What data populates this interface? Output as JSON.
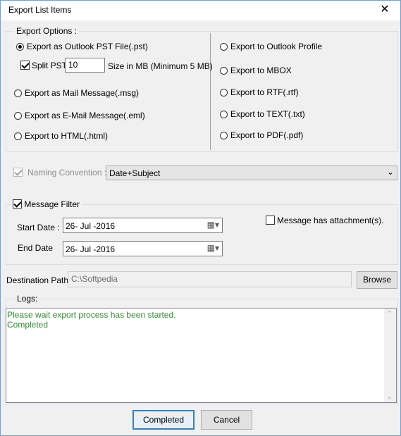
{
  "window": {
    "title": "Export List Items"
  },
  "export_options": {
    "legend": "Export Options :",
    "pst": "Export as Outlook PST File(.pst)",
    "split_pst_label": "Split PST",
    "split_size": "10",
    "size_label": "Size in MB (Minimum 5 MB)",
    "msg": "Export as Mail Message(.msg)",
    "eml": "Export as E-Mail Message(.eml)",
    "html": "Export to HTML(.html)",
    "outlook_profile": "Export to Outlook Profile",
    "mbox": "Export to MBOX",
    "rtf": "Export to RTF(.rtf)",
    "text": "Export to TEXT(.txt)",
    "pdf": "Export to PDF(.pdf)"
  },
  "naming": {
    "label": "Naming Convention :",
    "value": "Date+Subject"
  },
  "message_filter": {
    "legend": "Message Filter",
    "start_label": "Start Date :",
    "start_value": "26-  Jul  -2016",
    "end_label": "End Date",
    "end_value": "26-  Jul  -2016",
    "attachment_label": "Message has attachment(s)."
  },
  "destination": {
    "label": "Destination Path:",
    "value": "C:\\Softpedia",
    "browse": "Browse"
  },
  "logs": {
    "legend": "Logs:",
    "lines": [
      "Please wait export process has been started.",
      "Completed"
    ]
  },
  "buttons": {
    "completed": "Completed",
    "cancel": "Cancel"
  },
  "colors": {
    "log_text": "#2e8b2e",
    "accent": "#3c7fb1"
  }
}
